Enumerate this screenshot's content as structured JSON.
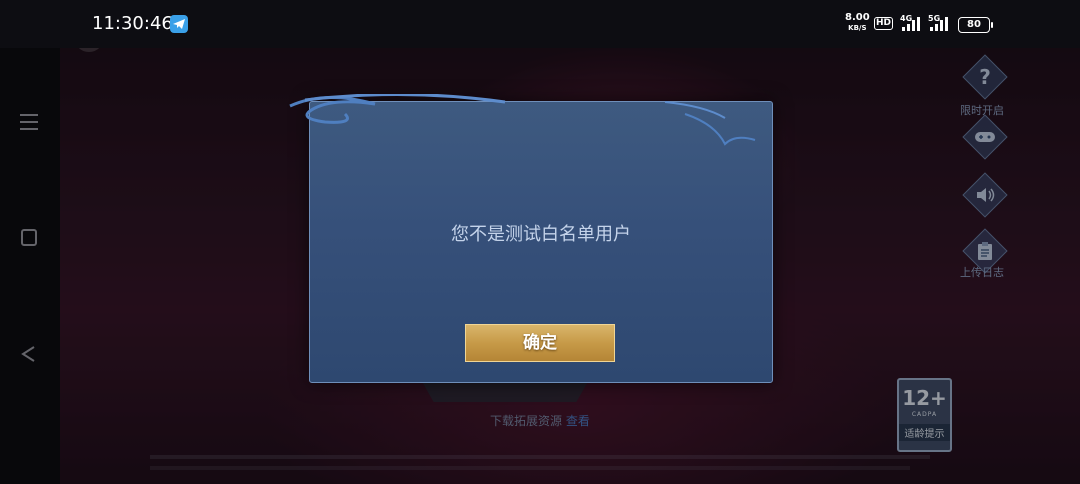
{
  "status_bar": {
    "time": "11:30:46",
    "net_speed_value": "8.00",
    "net_speed_unit": "KB/S",
    "hd_label": "HD",
    "signal1_label": "4G",
    "signal2_label": "5G",
    "battery": "80"
  },
  "game": {
    "side_buttons": {
      "help_label": "限时开启",
      "log_label": "上传日志"
    },
    "download_text": "下载拓展资源",
    "download_view": "查看",
    "age_badge": {
      "rating": "12+",
      "org": "CADPA",
      "note": "适龄提示"
    }
  },
  "dialog": {
    "message": "您不是测试白名单用户",
    "confirm_label": "确定"
  },
  "colors": {
    "dialog_bg": "#36507a",
    "confirm_gold": "#c79a48"
  }
}
